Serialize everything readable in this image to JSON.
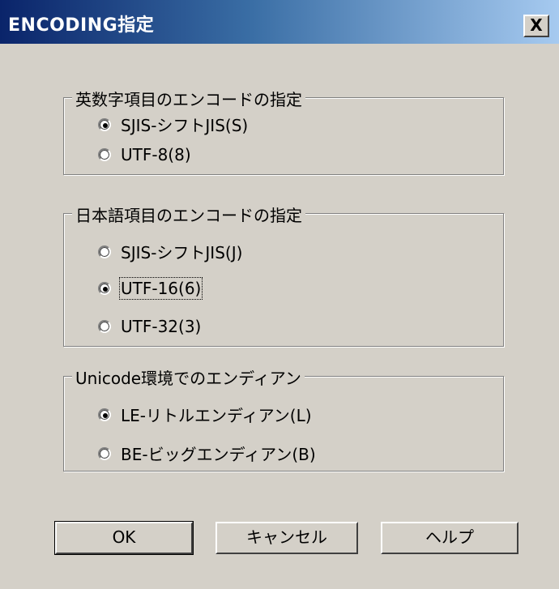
{
  "window": {
    "title": "ENCODING指定",
    "close_label": "X"
  },
  "groups": [
    {
      "title": "英数字項目のエンコードの指定",
      "options": [
        {
          "label": "SJIS-シフトJIS(S)",
          "checked": true
        },
        {
          "label": "UTF-8(8)",
          "checked": false
        }
      ]
    },
    {
      "title": "日本語項目のエンコードの指定",
      "options": [
        {
          "label": "SJIS-シフトJIS(J)",
          "checked": false
        },
        {
          "label": "UTF-16(6)",
          "checked": true,
          "focused": true
        },
        {
          "label": "UTF-32(3)",
          "checked": false
        }
      ]
    },
    {
      "title": "Unicode環境でのエンディアン",
      "options": [
        {
          "label": "LE-リトルエンディアン(L)",
          "checked": true
        },
        {
          "label": "BE-ビッグエンディアン(B)",
          "checked": false
        }
      ]
    }
  ],
  "buttons": {
    "ok": "OK",
    "cancel": "キャンセル",
    "help": "ヘルプ"
  }
}
